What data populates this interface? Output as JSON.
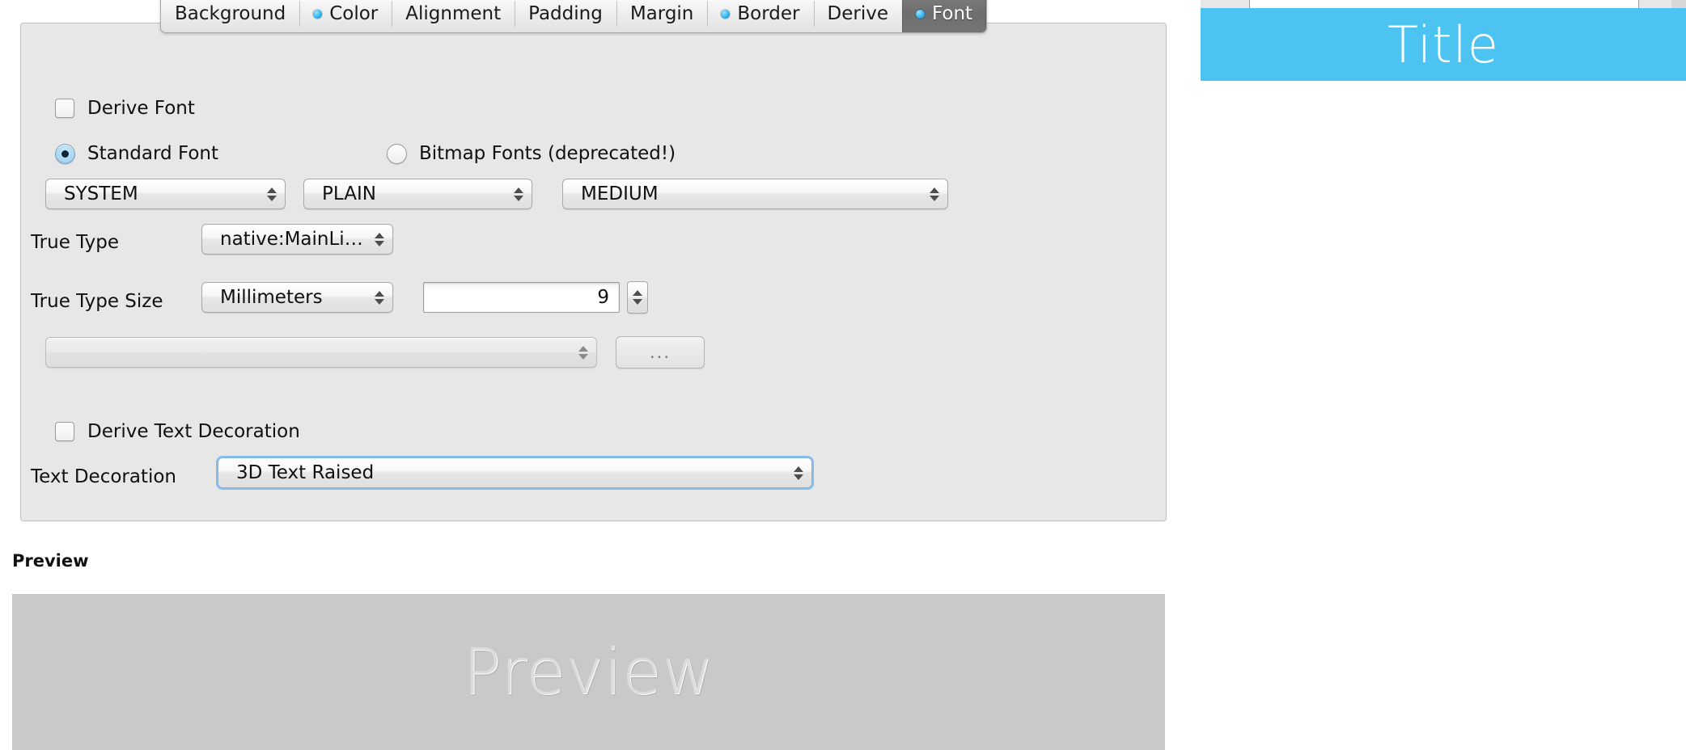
{
  "tabs": [
    {
      "label": "Background",
      "has_dot": false,
      "selected": false
    },
    {
      "label": "Color",
      "has_dot": true,
      "selected": false
    },
    {
      "label": "Alignment",
      "has_dot": false,
      "selected": false
    },
    {
      "label": "Padding",
      "has_dot": false,
      "selected": false
    },
    {
      "label": "Margin",
      "has_dot": false,
      "selected": false
    },
    {
      "label": "Border",
      "has_dot": true,
      "selected": false
    },
    {
      "label": "Derive",
      "has_dot": false,
      "selected": false
    },
    {
      "label": "Font",
      "has_dot": true,
      "selected": true
    }
  ],
  "font_panel": {
    "derive_font": {
      "label": "Derive Font",
      "checked": false
    },
    "font_source": {
      "standard": {
        "label": "Standard Font",
        "selected": true
      },
      "bitmap": {
        "label": "Bitmap Fonts (deprecated!)",
        "selected": false
      }
    },
    "standard_font": {
      "family": "SYSTEM",
      "style": "PLAIN",
      "size": "MEDIUM"
    },
    "true_type": {
      "label": "True Type",
      "value": "native:MainLight"
    },
    "true_type_size": {
      "label": "True Type Size",
      "unit": "Millimeters",
      "value": "9"
    },
    "extra_combo": {
      "value": "",
      "browse_label": "..."
    },
    "derive_text_decoration": {
      "label": "Derive Text Decoration",
      "checked": false
    },
    "text_decoration": {
      "label": "Text Decoration",
      "value": "3D Text Raised",
      "focused": true
    }
  },
  "preview": {
    "section_label": "Preview",
    "sample_text": "Preview"
  },
  "device_preview": {
    "title": "Title"
  },
  "colors": {
    "accent_dot": "#35b6ef",
    "selected_tab_bg": "#6e6e6e",
    "device_titlebar": "#4cc3f0",
    "panel_bg": "#e7e7e7",
    "preview_bg": "#c9c9c9",
    "focus_ring": "#7ab6e8"
  }
}
